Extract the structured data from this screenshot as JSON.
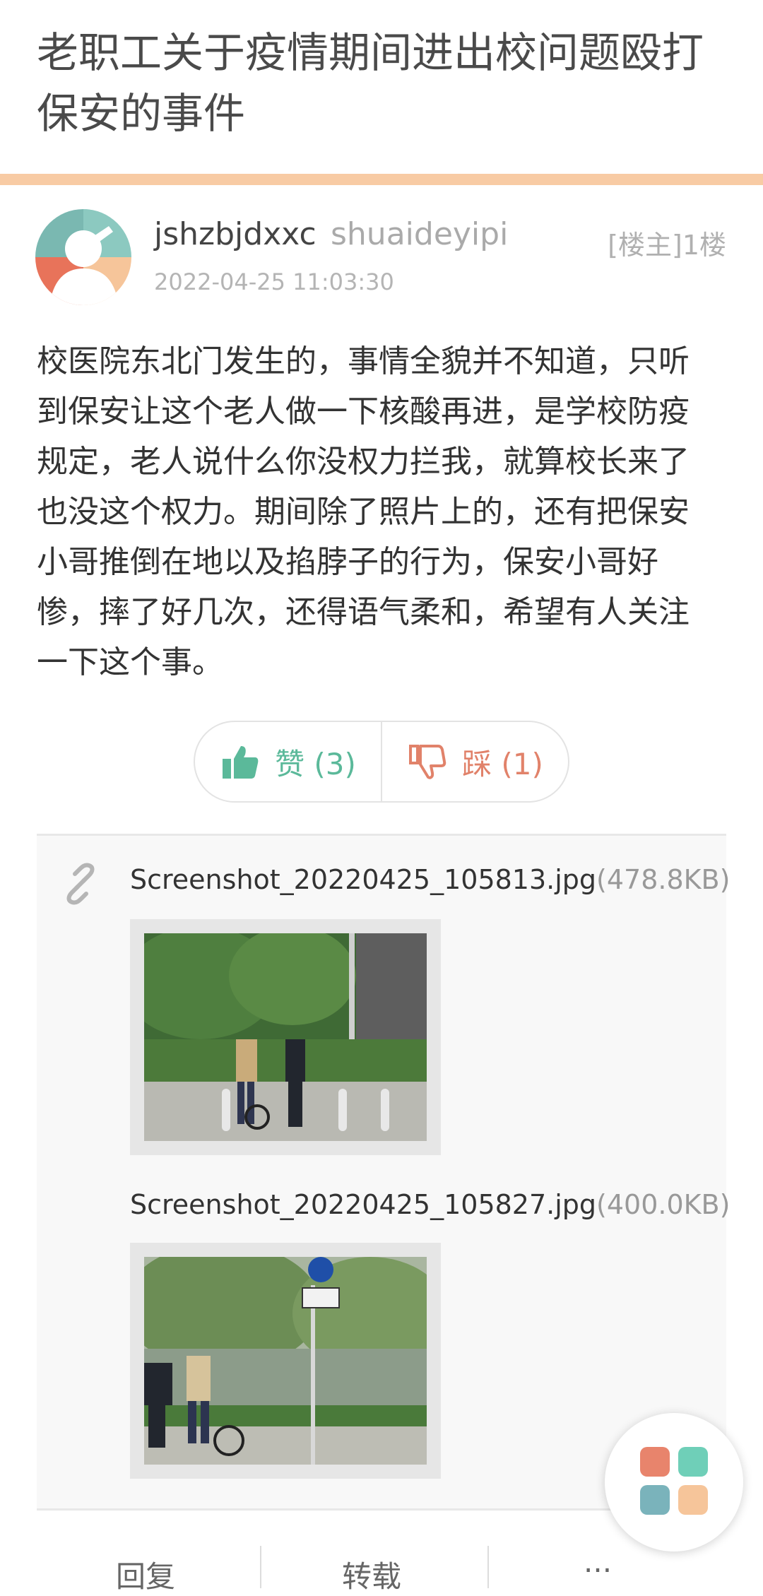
{
  "post": {
    "title": "老职工关于疫情期间进出校问题殴打保安的事件",
    "author": "jshzbjdxxc",
    "alt_name": "shuaideyipi",
    "floor": "[楼主]1楼",
    "timestamp": "2022-04-25 11:03:30",
    "content": "校医院东北门发生的，事情全貌并不知道，只听到保安让这个老人做一下核酸再进，是学校防疫规定，老人说什么你没权力拦我，就算校长来了也没这个权力。期间除了照片上的，还有把保安小哥推倒在地以及掐脖子的行为，保安小哥好惨，摔了好几次，还得语气柔和，希望有人关注一下这个事。"
  },
  "votes": {
    "like_label": "赞 (3)",
    "dislike_label": "踩 (1)"
  },
  "attachments": [
    {
      "name": "Screenshot_20220425_105813.jpg",
      "size": "(478.8KB)"
    },
    {
      "name": "Screenshot_20220425_105827.jpg",
      "size": "(400.0KB)"
    }
  ],
  "actions": {
    "reply": "回复",
    "repost": "转载",
    "more": "···"
  },
  "colors": {
    "accent_bar": "#f8cba4",
    "like": "#5bb99a",
    "dislike": "#e1826a"
  },
  "icons": [
    "avatar-icon",
    "thumbs-up-icon",
    "thumbs-down-icon",
    "link-icon",
    "app-grid-icon"
  ]
}
